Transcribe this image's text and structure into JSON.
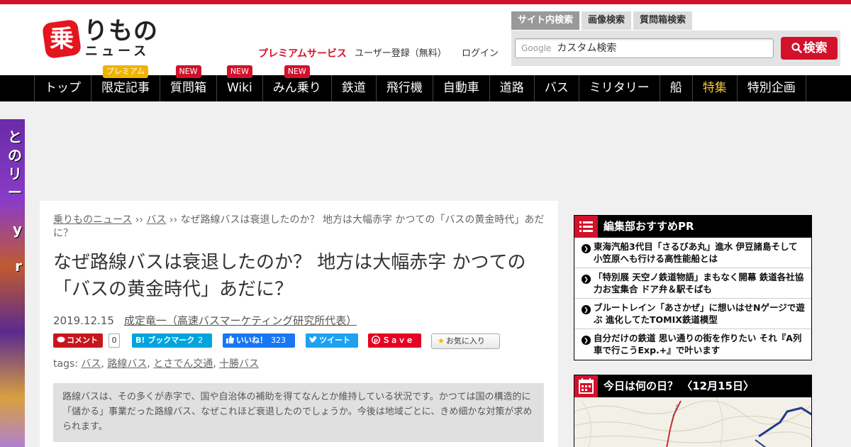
{
  "colors": {
    "brand_red": "#d2112b",
    "nav_bg": "#000000",
    "highlight_nav": "#f0c832",
    "premium_badge": "#f0b400"
  },
  "logo": {
    "mark": "乗",
    "main": "りもの",
    "sub": "ニュース",
    "icon": "bus-logo-icon"
  },
  "header_links": {
    "premium": "プレミアムサービス",
    "register": "ユーザー登録（無料）",
    "login": "ログイン"
  },
  "search": {
    "tabs": [
      "サイト内検索",
      "画像検索",
      "質問箱検索"
    ],
    "google_label": "Google",
    "placeholder": "カスタム検索",
    "button_label": "検索"
  },
  "nav": {
    "items": [
      {
        "label": "トップ",
        "badge": ""
      },
      {
        "label": "限定記事",
        "badge": "プレミアム"
      },
      {
        "label": "質問箱",
        "badge": "NEW"
      },
      {
        "label": "Wiki",
        "badge": "NEW"
      },
      {
        "label": "みん乗り",
        "badge": "NEW"
      },
      {
        "label": "鉄道",
        "badge": ""
      },
      {
        "label": "飛行機",
        "badge": ""
      },
      {
        "label": "自動車",
        "badge": ""
      },
      {
        "label": "道路",
        "badge": ""
      },
      {
        "label": "バス",
        "badge": ""
      },
      {
        "label": "ミリタリー",
        "badge": ""
      },
      {
        "label": "船",
        "badge": ""
      },
      {
        "label": "特集",
        "badge": ""
      },
      {
        "label": "特別企画",
        "badge": ""
      }
    ]
  },
  "left_ad": {
    "text": "との\nリー\ny\nr"
  },
  "article": {
    "breadcrumb": {
      "home": "乗りものニュース",
      "sep1": " ›› ",
      "category": "バス",
      "sep2": " ›› ",
      "current": "なぜ路線バスは衰退したのか？ 地方は大幅赤字 かつての「バスの黄金時代」あだに？"
    },
    "title": "なぜ路線バスは衰退したのか？ 地方は大幅赤字 かつての「バスの黄金時代」あだに？",
    "date": "2019.12.15",
    "author": "成定竜一（高速バスマーケティング研究所代表）",
    "share": {
      "comment_label": "コメント",
      "comment_count": "0",
      "hatena_label": "B! ブックマーク",
      "hatena_count": "2",
      "fb_label": "いいね！",
      "fb_count": "323",
      "tw_label": "ツイート",
      "pin_label": "Ｓａｖｅ",
      "fav_label": "お気に入り"
    },
    "tags_label": "tags:",
    "tags": [
      "バス",
      "路線バス",
      "とさでん交通",
      "十勝バス"
    ],
    "lead": "路線バスは、その多くが赤字で、国や自治体の補助を得てなんとか維持している状況です。かつては国の構造的に「儲かる」事業だった路線バス、なぜこれほど衰退したのでしょうか。今後は地域ごとに、きめ細かな対策が求められます。"
  },
  "sidebar": {
    "pr_title": "編集部おすすめPR",
    "pr_items": [
      "東海汽船3代目「さるびあ丸」進水 伊豆諸島そして小笠原へも行ける高性能船とは",
      "「特別展 天空ノ鉄道物語」まもなく開幕 鉄道各社協力お宝集合 ドア弁＆駅そばも",
      "ブルートレイン「あさかぜ」に想いはせNゲージで遊ぶ 進化してたTOMIX鉄道模型",
      "自分だけの鉄道 思い通りの街を作りたい それ『A列車で行こうExp.+』で叶います"
    ],
    "today_title": "今日は何の日？ 〈12月15日〉"
  }
}
